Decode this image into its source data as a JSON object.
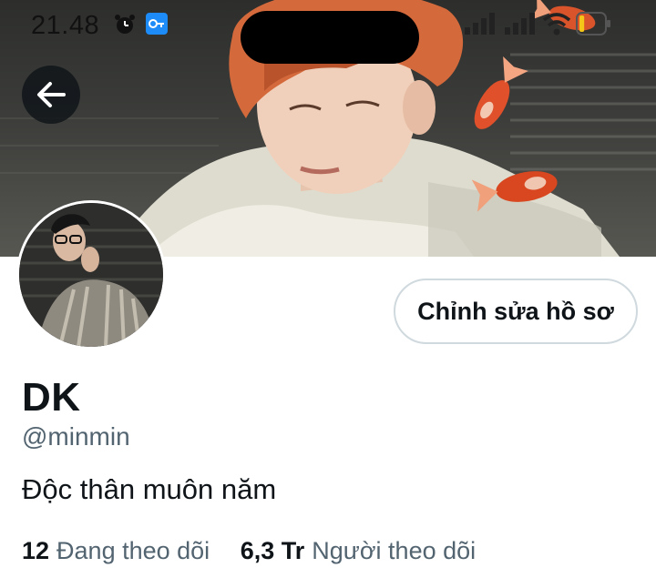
{
  "status_bar": {
    "time": "21.48",
    "battery_level": 0.2,
    "battery_color": "#f5c518",
    "icons": [
      "alarm-icon",
      "vpn-key-icon",
      "signal-icon",
      "signal-icon",
      "wifi-icon",
      "battery-icon"
    ]
  },
  "navigation": {
    "back_icon": "arrow-left-icon"
  },
  "profile": {
    "display_name": "DK",
    "username": "@minmin",
    "bio": "Độc thân muôn năm",
    "edit_button_label": "Chỉnh sửa hồ sơ",
    "stats": {
      "following_count": "12",
      "following_label": "Đang theo dõi",
      "followers_count": "6,3 Tr",
      "followers_label": "Người theo dõi"
    }
  },
  "colors": {
    "text_primary": "#0f1419",
    "text_secondary": "#536471",
    "border": "#cfd9de",
    "background": "#ffffff"
  }
}
